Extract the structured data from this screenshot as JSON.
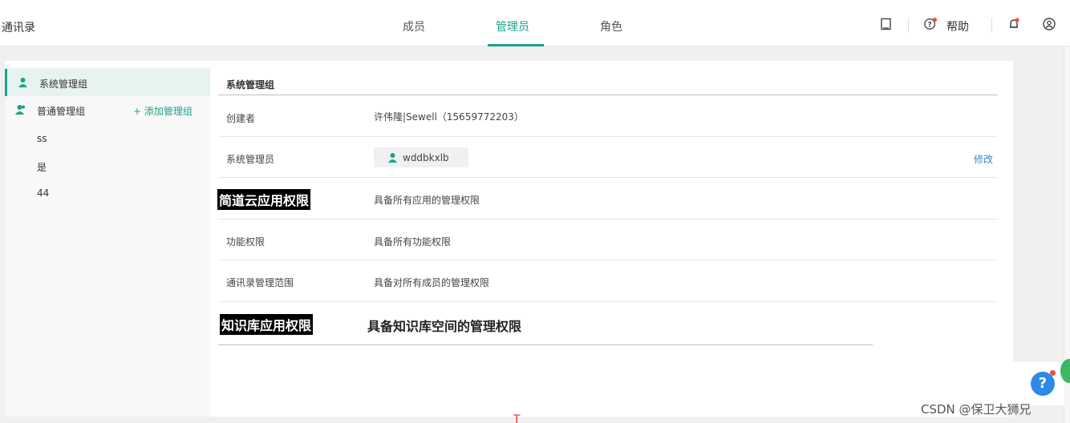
{
  "app": {
    "title": "通讯录"
  },
  "tabs": [
    {
      "label": "成员"
    },
    {
      "label": "管理员",
      "active": true
    },
    {
      "label": "角色"
    }
  ],
  "header_tools": {
    "help_label": "帮助"
  },
  "sidebar": {
    "groups": [
      {
        "label": "系统管理组",
        "active": true
      },
      {
        "label": "普通管理组"
      }
    ],
    "add_group_label": "+ 添加管理组",
    "sub_items": [
      "ss",
      "是",
      "44"
    ]
  },
  "main": {
    "section_title": "系统管理组",
    "rows": [
      {
        "label": "创建者",
        "value": "许伟隆|Sewell（15659772203）"
      },
      {
        "label": "系统管理员",
        "value": "wddbkxlb",
        "action": "修改"
      },
      {
        "label": "简道云应用权限",
        "value": "具备所有应用的管理权限"
      },
      {
        "label": "功能权限",
        "value": "具备所有功能权限"
      },
      {
        "label": "通讯录管理范围",
        "value": "具备对所有成员的管理权限"
      },
      {
        "label": "知识库应用权限",
        "value": "具备知识库空间的管理权限"
      }
    ]
  },
  "help_float": {
    "symbol": "?"
  },
  "watermark": "CSDN @保卫大狮兄",
  "stray_mark": "T",
  "colors": {
    "accent": "#1aa38a",
    "link": "#3a86c8",
    "help_blue": "#2f8ae5"
  }
}
